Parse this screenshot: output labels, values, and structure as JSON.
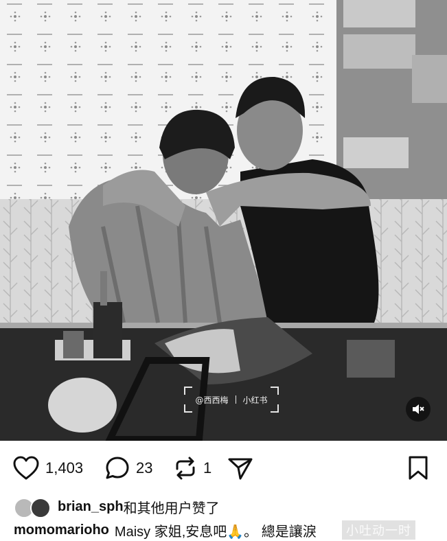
{
  "post": {
    "photo_alt": "",
    "watermark": {
      "handle": "@西西梅",
      "app": "小红书"
    }
  },
  "actions": {
    "likes_count": "1,403",
    "comments_count": "23",
    "reposts_count": "1"
  },
  "likes": {
    "user": "brian_sph",
    "suffix": " 和其他用户赞了"
  },
  "caption": {
    "user": "momomarioho",
    "text": "Maisy 家姐,安息吧🙏。 總是讓淚",
    "overlay_watermark": "小吐动一时"
  },
  "colors": {
    "icon": "#111111",
    "photo_bg": "#bdbdbd"
  }
}
